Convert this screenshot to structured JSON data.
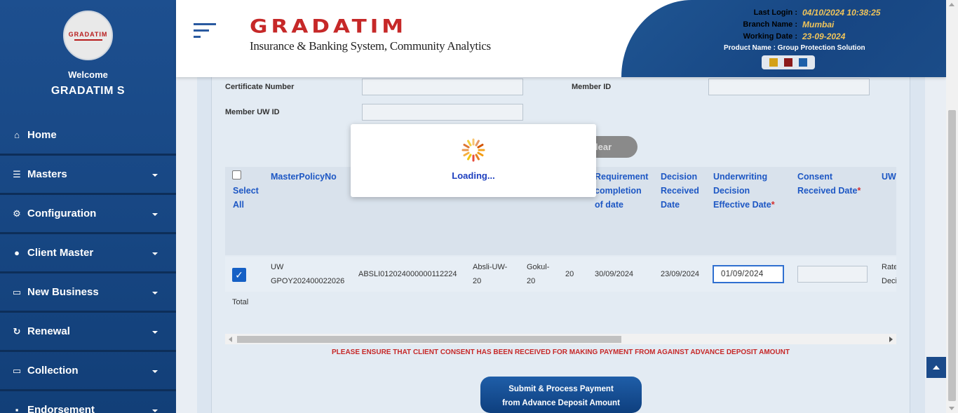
{
  "sidebar": {
    "avatar_logo": "GRADATIM",
    "welcome": "Welcome",
    "user_name": "GRADATIM S",
    "items": [
      {
        "label": "Home",
        "icon": "home-icon",
        "has_caret": false
      },
      {
        "label": "Masters",
        "icon": "database-icon",
        "has_caret": true
      },
      {
        "label": "Configuration",
        "icon": "cogs-icon",
        "has_caret": true
      },
      {
        "label": "Client Master",
        "icon": "user-icon",
        "has_caret": true
      },
      {
        "label": "New Business",
        "icon": "desktop-icon",
        "has_caret": true
      },
      {
        "label": "Renewal",
        "icon": "refresh-icon",
        "has_caret": true
      },
      {
        "label": "Collection",
        "icon": "desktop-icon",
        "has_caret": true
      },
      {
        "label": "Endorsement",
        "icon": "briefcase-icon",
        "has_caret": true
      }
    ]
  },
  "header": {
    "brand_name": "GRADATIM",
    "brand_tagline": "Insurance & Banking System, Community Analytics",
    "last_login_label": "Last Login :",
    "last_login_value": "04/10/2024 10:38:25",
    "branch_label": "Branch Name :",
    "branch_value": "Mumbai",
    "working_date_label": "Working Date :",
    "working_date_value": "23-09-2024",
    "product_label": "Product Name : Group Protection Solution",
    "theme_colors": [
      "#d4a017",
      "#8b1a1a",
      "#1d5fa8"
    ]
  },
  "form": {
    "certificate_number_label": "Certificate Number",
    "member_id_label": "Member ID",
    "member_uw_id_label": "Member UW ID",
    "clear_label": "lear"
  },
  "table": {
    "select_all": [
      "Select",
      "All"
    ],
    "headers": {
      "master_policy": "MasterPolicyNo",
      "req_completion": [
        "Requirement",
        "completion",
        "of date"
      ],
      "decision_received": [
        "Decision",
        "Received",
        "Date"
      ],
      "uw_decision_eff": [
        "Underwriting",
        "Decision",
        "Effective Date"
      ],
      "consent_received": [
        "Consent",
        "Received Date"
      ],
      "uw_trunc": "UW"
    },
    "required_mark": "*",
    "row": {
      "master_policy": [
        "UW",
        "GPOY202400022026"
      ],
      "cert_no": "ABSLI012024000000112224",
      "col3": [
        "Absli-UW-",
        "20"
      ],
      "col4": [
        "Gokul-",
        "20"
      ],
      "col5": "20",
      "req_completion_date": "30/09/2024",
      "decision_received_date": "23/09/2024",
      "uw_decision_effective_date": "01/09/2024",
      "consent_received_date": "",
      "uw_trunc": [
        "Rate",
        "Deci"
      ]
    },
    "total_label": "Total"
  },
  "warning": "PLEASE ENSURE THAT CLIENT CONSENT HAS BEEN RECEIVED FOR MAKING PAYMENT FROM AGAINST ADVANCE DEPOSIT AMOUNT",
  "submit": [
    "Submit & Process Payment",
    "from Advance Deposit Amount"
  ],
  "loading": "Loading..."
}
